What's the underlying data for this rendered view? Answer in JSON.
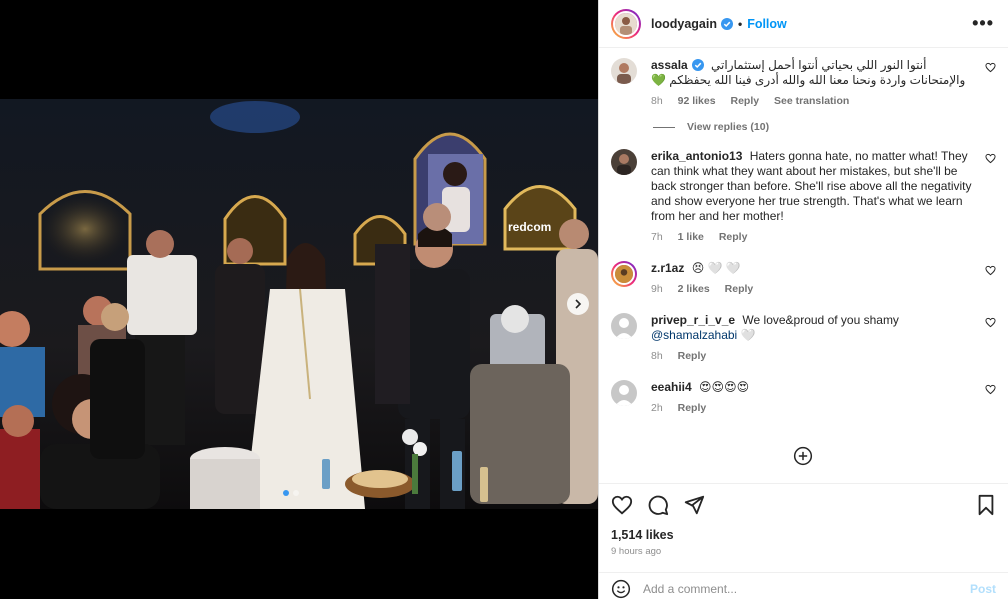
{
  "post": {
    "author": "loodyagain",
    "separator": "•",
    "follow_label": "Follow",
    "more_label": "•••",
    "likes": "1,514 likes",
    "time_ago": "9 hours ago"
  },
  "photo": {
    "stage_sign": "redcom",
    "carousel_dots": 2,
    "active_dot": 0
  },
  "comments": [
    {
      "username": "assala",
      "verified": true,
      "text": "أنتوا النور اللي بحياتي أنتوا أحمل إستثماراتي والإمتحانات واردة ونحنا معنا الله والله أدرى فينا الله يحفظكم 💚",
      "time": "8h",
      "likes": "92 likes",
      "reply": "Reply",
      "see_translation": "See translation",
      "view_replies": "View replies (10)"
    },
    {
      "username": "erika_antonio13",
      "text": "Haters gonna hate, no matter what! They can think what they want about her mistakes, but she'll be back stronger than before. She'll rise above all the negativity and show everyone her true strength. That's what we learn from her and her mother!",
      "time": "7h",
      "likes": "1 like",
      "reply": "Reply"
    },
    {
      "username": "z.r1az",
      "text": "😣 🤍 🤍",
      "time": "9h",
      "likes": "2 likes",
      "reply": "Reply"
    },
    {
      "username": "privep_r_i_v_e",
      "text": "We love&proud of you shamy",
      "mention": "@shamalzahabi",
      "text_tail": "🤍",
      "time": "8h",
      "reply": "Reply"
    },
    {
      "username": "eeahii4",
      "text": "😍😍😍😍",
      "time": "2h",
      "reply": "Reply"
    }
  ],
  "add_comment": {
    "placeholder": "Add a comment...",
    "post_label": "Post"
  },
  "colors": {
    "accent": "#0095f6",
    "verified": "#3897f0",
    "muted": "#8e8e8e"
  }
}
